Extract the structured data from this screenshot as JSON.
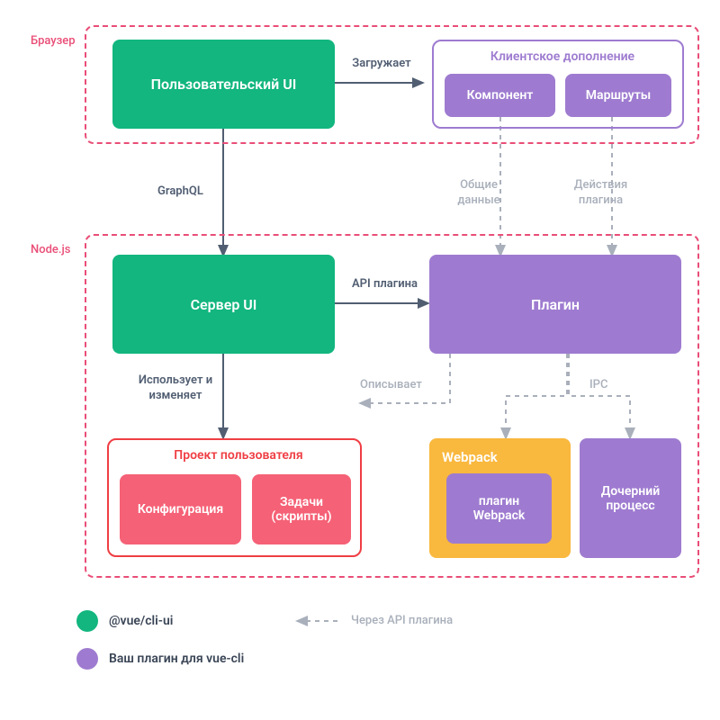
{
  "panels": {
    "browser": "Браузер",
    "nodejs": "Node.js"
  },
  "boxes": {
    "user_ui": "Пользовательский UI",
    "client_addon_title": "Клиентское дополнение",
    "component": "Компонент",
    "routes": "Маршруты",
    "server_ui": "Сервер UI",
    "plugin": "Плагин",
    "user_project_title": "Проект пользователя",
    "configuration": "Конфигурация",
    "tasks": "Задачи (скрипты)",
    "webpack": "Webpack",
    "webpack_plugin": "плагин Webpack",
    "child_process": "Дочерний процесс"
  },
  "links": {
    "loads": "Загружает",
    "graphql": "GraphQL",
    "shared_data": "Общие данные",
    "plugin_actions": "Действия плагина",
    "plugin_api": "API плагина",
    "uses_modifies": "Использует и изменяет",
    "describes": "Описывает",
    "ipc": "IPC"
  },
  "legend": {
    "vue_cli_ui": "@vue/cli-ui",
    "your_plugin": "Ваш плагин для vue-cli",
    "via_api": "Через API плагина"
  }
}
